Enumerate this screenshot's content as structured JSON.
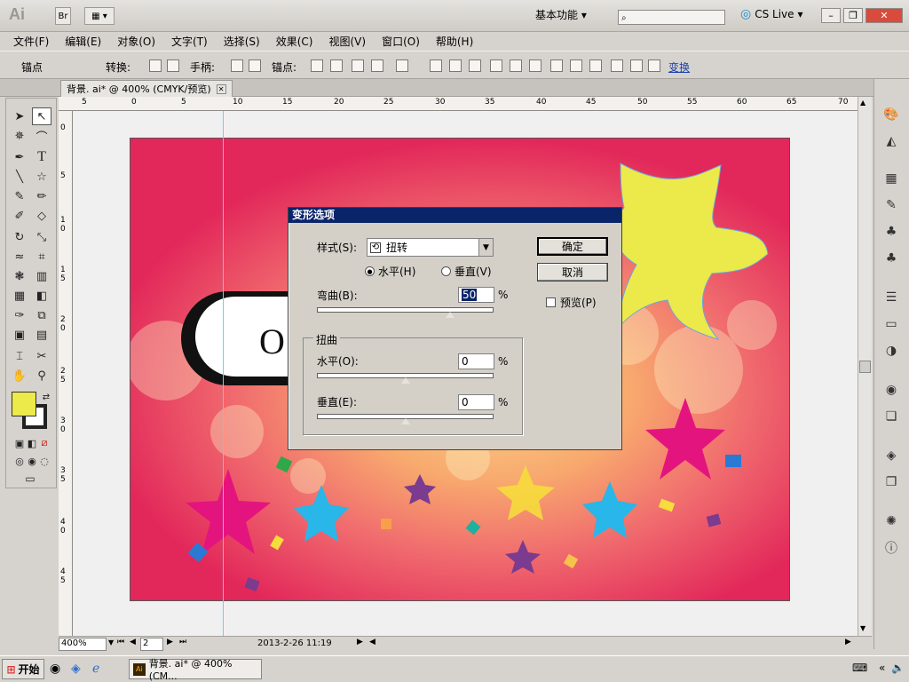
{
  "app": {
    "logo": "Ai",
    "bridge_label": "Br",
    "workspace": "基本功能",
    "cs_live": "CS Live"
  },
  "menu": [
    "文件(F)",
    "编辑(E)",
    "对象(O)",
    "文字(T)",
    "选择(S)",
    "效果(C)",
    "视图(V)",
    "窗口(O)",
    "帮助(H)"
  ],
  "control": {
    "anchor": "锚点",
    "convert": "转换:",
    "handles": "手柄:",
    "anchors": "锚点:",
    "transform_link": "变换"
  },
  "document_tab": {
    "title": "背景. ai* @ 400% (CMYK/预览)"
  },
  "ruler_top": [
    "5",
    "0",
    "5",
    "10",
    "15",
    "20",
    "25",
    "30",
    "35",
    "40",
    "45",
    "50",
    "55",
    "60",
    "65",
    "70"
  ],
  "ruler_left": [
    "0",
    "5",
    "1 0",
    "1 5",
    "2 0",
    "2 5",
    "3 0",
    "3 5",
    "4 0",
    "4 5"
  ],
  "artboard": {
    "letter": "O"
  },
  "dialog": {
    "title": "变形选项",
    "style_label": "样式(S):",
    "style_value": "扭转",
    "horizontal": "水平(H)",
    "vertical": "垂直(V)",
    "orientation_selected": "horizontal",
    "bend_label": "弯曲(B):",
    "bend_value": "50",
    "percent": "%",
    "distortion_group": "扭曲",
    "dist_h_label": "水平(O):",
    "dist_h_value": "0",
    "dist_v_label": "垂直(E):",
    "dist_v_value": "0",
    "ok": "确定",
    "cancel": "取消",
    "preview": "预览(P)",
    "preview_checked": false
  },
  "status": {
    "zoom": "400%",
    "artboard_num": "2",
    "datetime": "2013-2-26  11:19"
  },
  "taskbar": {
    "start": "开始",
    "task": "背景. ai* @ 400% (CM..."
  },
  "colors": {
    "fill": "#ece94a",
    "title_bar": "#0a246a",
    "magenta": "#e4147e",
    "cyan": "#29b6e8",
    "purple": "#7b3b8f"
  }
}
